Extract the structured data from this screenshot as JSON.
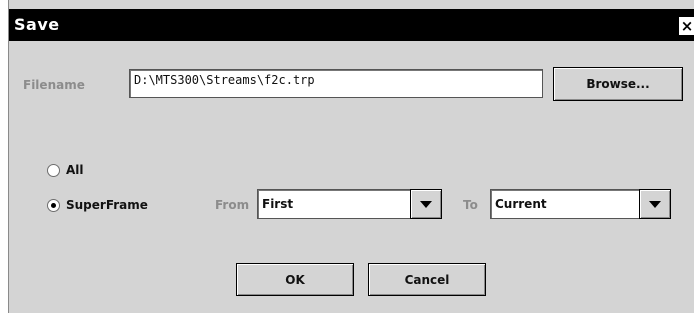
{
  "window": {
    "title": "Save",
    "close_glyph": "×"
  },
  "filename": {
    "label": "Filename",
    "value": "D:\\MTS300\\Streams\\f2c.trp"
  },
  "browse_label": "Browse...",
  "options": {
    "all_label": "All",
    "superframe_label": "SuperFrame",
    "selected": "SuperFrame"
  },
  "range": {
    "from_label": "From",
    "from_value": "First",
    "to_label": "To",
    "to_value": "Current"
  },
  "buttons": {
    "ok": "OK",
    "cancel": "Cancel"
  },
  "colors": {
    "titlebar": "#000000",
    "dialog_bg": "#d4d4d4",
    "muted_text": "#8c8c8c"
  },
  "icons": {
    "close": "close-icon",
    "radio_off": "radio-unchecked-icon",
    "radio_on": "radio-checked-icon",
    "dropdown": "chevron-down-icon"
  }
}
